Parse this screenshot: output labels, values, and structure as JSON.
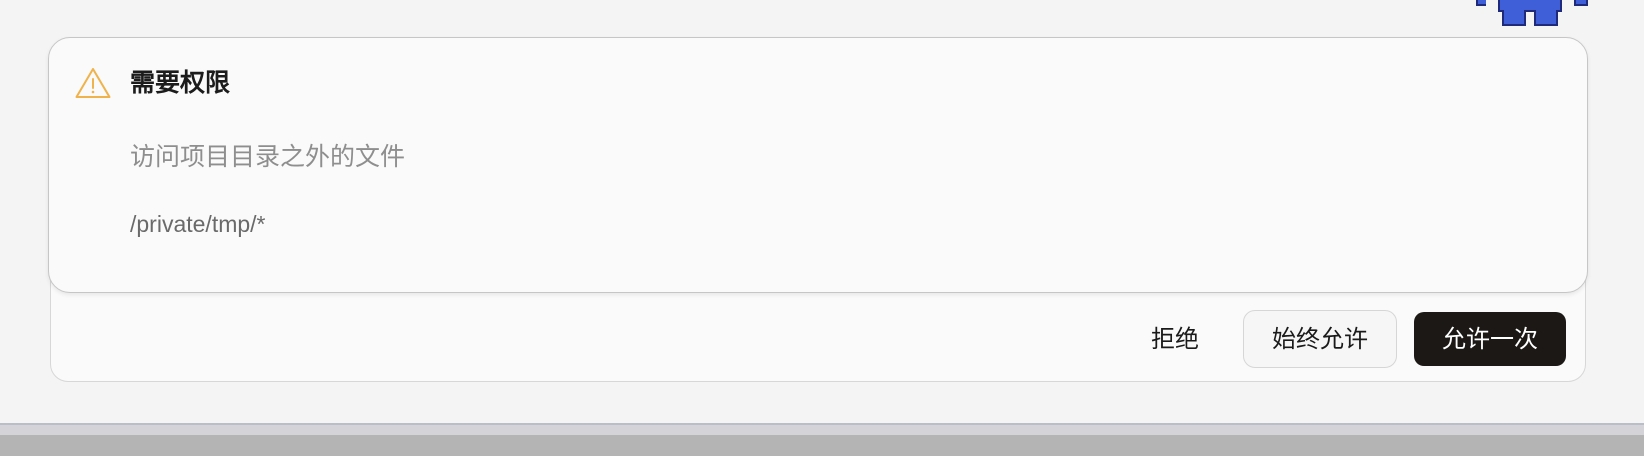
{
  "dialog": {
    "title": "需要权限",
    "description": "访问项目目录之外的文件",
    "path": "/private/tmp/*",
    "icon": "warning-icon",
    "accent_color": "#f0b24a"
  },
  "actions": {
    "deny_label": "拒绝",
    "always_allow_label": "始终允许",
    "allow_once_label": "允许一次"
  },
  "decor": {
    "mascot_icon": "pixel-mascot-icon",
    "mascot_color": "#3f5fd8"
  }
}
